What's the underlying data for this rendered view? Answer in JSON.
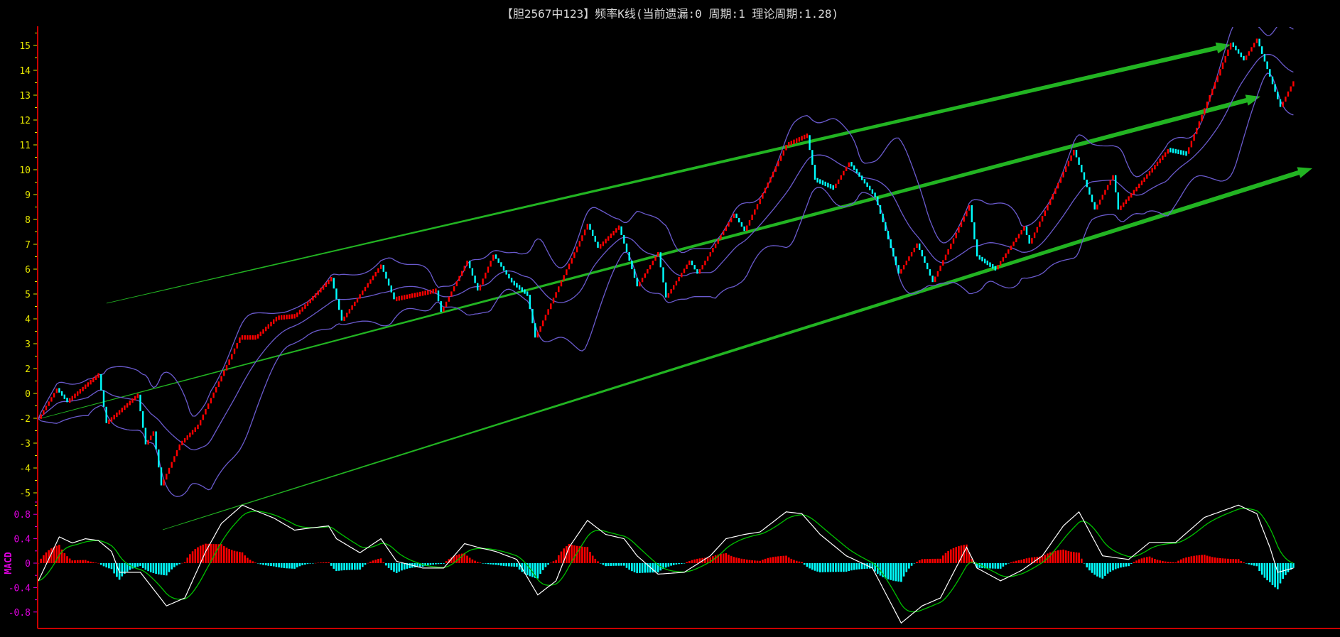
{
  "title": "【胆2567中123】频率K线(当前遗漏:0 周期:1 理论周期:1.28)",
  "colors": {
    "up": "#ff0000",
    "down": "#00ffff",
    "band": "#6a5acd",
    "dif": "#ffffff",
    "dea": "#00c000",
    "axis": "#cc0000",
    "price_label": "#e6e600",
    "macd_label": "#e000e0",
    "trend": "#22b422"
  },
  "chart_data": [
    {
      "type": "candlestick",
      "title": "【胆2567中123】频率K线(当前遗漏:0 周期:1 理论周期:1.28)",
      "y_tick_labels": [
        "15",
        "14",
        "13",
        "12",
        "11",
        "10",
        "9",
        "8",
        "7",
        "6",
        "5",
        "4",
        "3",
        "2",
        "0",
        "-2",
        "-3",
        "-4",
        "-5"
      ],
      "ylim": [
        -3,
        15
      ],
      "bar_count": 481,
      "overlay": "Bollinger bands (20, 2)",
      "close_waypoints": [
        [
          0,
          -0.02
        ],
        [
          7,
          1.19
        ],
        [
          11,
          0.67
        ],
        [
          23,
          1.77
        ],
        [
          26,
          -0.19
        ],
        [
          38,
          0.95
        ],
        [
          41,
          -1.05
        ],
        [
          44,
          -0.53
        ],
        [
          47,
          -2.7
        ],
        [
          54,
          -1.05
        ],
        [
          61,
          -0.29
        ],
        [
          77,
          3.25
        ],
        [
          83,
          3.25
        ],
        [
          91,
          4.04
        ],
        [
          98,
          4.11
        ],
        [
          112,
          5.65
        ],
        [
          116,
          3.93
        ],
        [
          131,
          6.17
        ],
        [
          136,
          4.79
        ],
        [
          152,
          5.14
        ],
        [
          154,
          4.28
        ],
        [
          164,
          6.34
        ],
        [
          168,
          5.14
        ],
        [
          174,
          6.58
        ],
        [
          181,
          5.48
        ],
        [
          187,
          4.97
        ],
        [
          190,
          3.25
        ],
        [
          210,
          7.82
        ],
        [
          214,
          6.86
        ],
        [
          222,
          7.72
        ],
        [
          229,
          5.31
        ],
        [
          237,
          6.68
        ],
        [
          240,
          4.86
        ],
        [
          249,
          6.34
        ],
        [
          252,
          5.82
        ],
        [
          266,
          8.23
        ],
        [
          270,
          7.54
        ],
        [
          286,
          11.0
        ],
        [
          294,
          11.39
        ],
        [
          297,
          9.6
        ],
        [
          304,
          9.26
        ],
        [
          310,
          10.29
        ],
        [
          320,
          8.92
        ],
        [
          329,
          5.82
        ],
        [
          336,
          7.03
        ],
        [
          342,
          5.48
        ],
        [
          356,
          8.57
        ],
        [
          359,
          6.51
        ],
        [
          366,
          6.0
        ],
        [
          377,
          7.72
        ],
        [
          379,
          7.03
        ],
        [
          396,
          10.8
        ],
        [
          404,
          8.4
        ],
        [
          411,
          9.78
        ],
        [
          413,
          8.4
        ],
        [
          432,
          10.8
        ],
        [
          439,
          10.64
        ],
        [
          456,
          15.1
        ],
        [
          461,
          14.42
        ],
        [
          466,
          15.27
        ],
        [
          475,
          12.53
        ],
        [
          480,
          13.56
        ]
      ]
    },
    {
      "type": "line",
      "title": "MACD",
      "y_tick_labels": [
        "0.8",
        "0.4",
        "0",
        "-0.4",
        "-0.8"
      ],
      "y_ticks": [
        0.8,
        0.4,
        0,
        -0.4,
        -0.8
      ],
      "ylim": [
        -1.05,
        1.05
      ],
      "series": [
        {
          "name": "DIF",
          "color": "white"
        },
        {
          "name": "DEA",
          "color": "green",
          "ema_period": 9
        },
        {
          "name": "MACD histogram",
          "color": "red/cyan"
        }
      ],
      "dif_waypoints": [
        [
          0,
          -0.29
        ],
        [
          8,
          0.43
        ],
        [
          13,
          0.33
        ],
        [
          18,
          0.4
        ],
        [
          23,
          0.37
        ],
        [
          28,
          0.19
        ],
        [
          31,
          -0.15
        ],
        [
          39,
          -0.15
        ],
        [
          49,
          -0.7
        ],
        [
          56,
          -0.57
        ],
        [
          64,
          0.19
        ],
        [
          70,
          0.65
        ],
        [
          78,
          0.95
        ],
        [
          83,
          0.86
        ],
        [
          90,
          0.74
        ],
        [
          98,
          0.54
        ],
        [
          103,
          0.57
        ],
        [
          111,
          0.61
        ],
        [
          114,
          0.4
        ],
        [
          123,
          0.17
        ],
        [
          131,
          0.4
        ],
        [
          137,
          0.03
        ],
        [
          147,
          -0.08
        ],
        [
          155,
          -0.08
        ],
        [
          163,
          0.32
        ],
        [
          168,
          0.26
        ],
        [
          175,
          0.19
        ],
        [
          183,
          0.06
        ],
        [
          191,
          -0.52
        ],
        [
          198,
          -0.29
        ],
        [
          203,
          0.26
        ],
        [
          210,
          0.7
        ],
        [
          217,
          0.47
        ],
        [
          224,
          0.4
        ],
        [
          229,
          0.12
        ],
        [
          237,
          -0.18
        ],
        [
          247,
          -0.15
        ],
        [
          257,
          0.12
        ],
        [
          263,
          0.4
        ],
        [
          270,
          0.47
        ],
        [
          276,
          0.51
        ],
        [
          286,
          0.84
        ],
        [
          292,
          0.81
        ],
        [
          299,
          0.47
        ],
        [
          309,
          0.12
        ],
        [
          319,
          -0.08
        ],
        [
          330,
          -0.98
        ],
        [
          338,
          -0.7
        ],
        [
          345,
          -0.57
        ],
        [
          355,
          0.26
        ],
        [
          359,
          -0.08
        ],
        [
          368,
          -0.29
        ],
        [
          376,
          -0.12
        ],
        [
          384,
          0.12
        ],
        [
          392,
          0.61
        ],
        [
          398,
          0.84
        ],
        [
          407,
          0.12
        ],
        [
          417,
          0.06
        ],
        [
          425,
          0.34
        ],
        [
          435,
          0.34
        ],
        [
          446,
          0.75
        ],
        [
          459,
          0.95
        ],
        [
          466,
          0.81
        ],
        [
          471,
          0.26
        ],
        [
          474,
          -0.15
        ],
        [
          480,
          -0.08
        ]
      ]
    }
  ]
}
